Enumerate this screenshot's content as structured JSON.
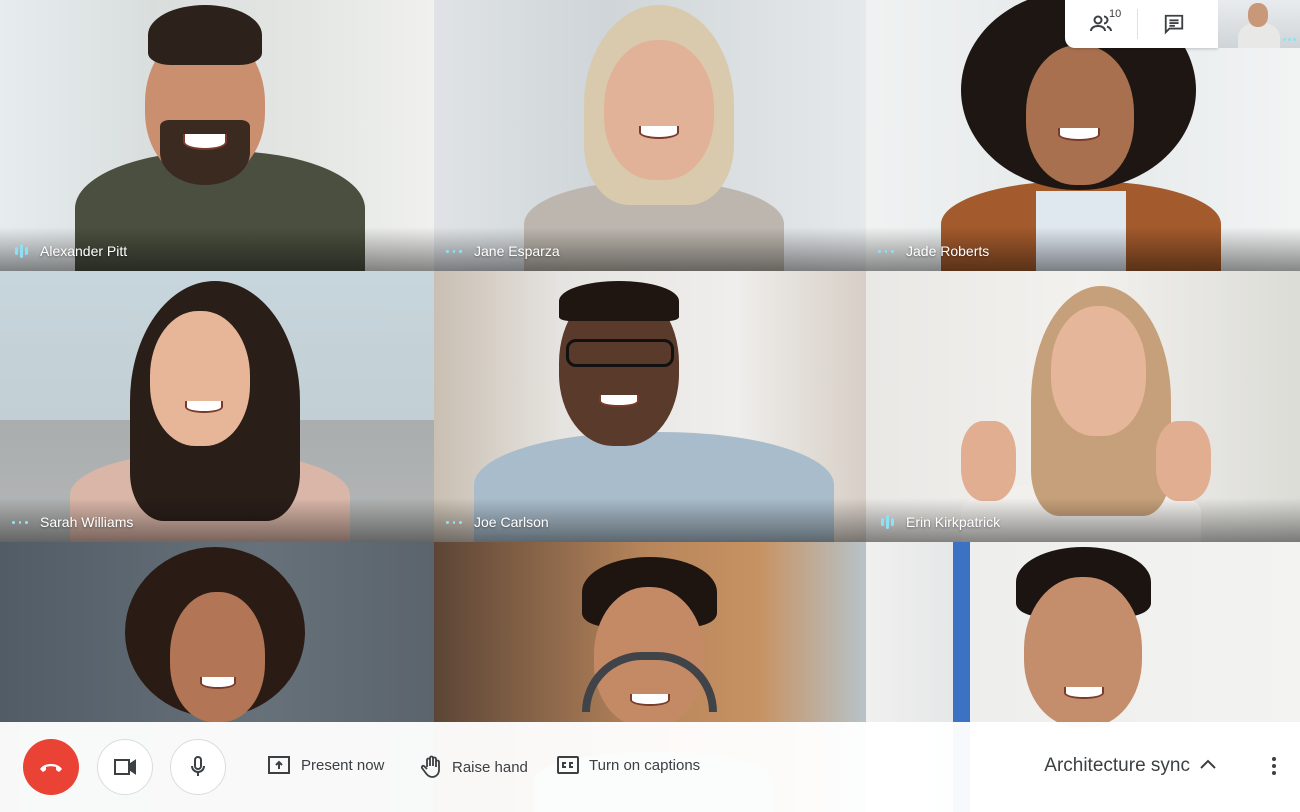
{
  "header": {
    "participants_count": "10",
    "participants_icon": "people-icon",
    "chat_icon": "chat-icon"
  },
  "participants": [
    {
      "name": "Alexander Pitt",
      "status": "speaking"
    },
    {
      "name": "Jane Esparza",
      "status": "idle"
    },
    {
      "name": "Jade Roberts",
      "status": "idle"
    },
    {
      "name": "Sarah Williams",
      "status": "idle"
    },
    {
      "name": "Joe Carlson",
      "status": "idle"
    },
    {
      "name": "Erin Kirkpatrick",
      "status": "speaking"
    },
    {
      "name": "",
      "status": "none"
    },
    {
      "name": "",
      "status": "none"
    },
    {
      "name": "",
      "status": "none"
    }
  ],
  "controls": {
    "end_call_icon": "hang-up-icon",
    "camera_icon": "videocam-icon",
    "mic_icon": "mic-icon",
    "present_label": "Present now",
    "raise_hand_label": "Raise hand",
    "captions_label": "Turn on captions",
    "meeting_title": "Architecture sync"
  },
  "colors": {
    "end_call": "#ea4335",
    "indicator": "#8ee0f5"
  }
}
